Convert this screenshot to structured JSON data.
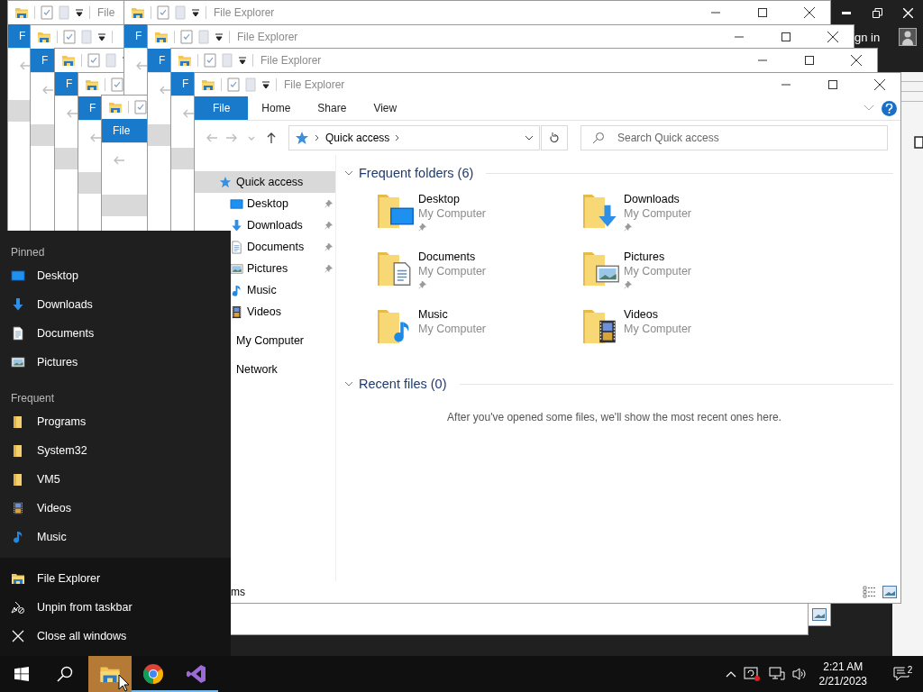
{
  "desktop_app": {
    "sign_in": "gn in"
  },
  "background_windows": [
    {
      "title": "File",
      "file_tab": "F"
    },
    {
      "file_tab": "F"
    },
    {
      "file_tab": "F"
    },
    {
      "file_tab": "F"
    },
    {
      "title": "File Explorer",
      "file_tab": "F"
    },
    {
      "file_tab": "File"
    },
    {
      "title": "File Explorer",
      "file_tab": "F"
    },
    {
      "title": "File Explorer",
      "file_tab": "F"
    }
  ],
  "main_window": {
    "title": "File Explorer",
    "ribbon_tabs": [
      {
        "label": "File",
        "selected": true
      },
      {
        "label": "Home",
        "selected": false
      },
      {
        "label": "Share",
        "selected": false
      },
      {
        "label": "View",
        "selected": false
      }
    ],
    "address": {
      "path": "Quick access"
    },
    "search": {
      "placeholder": "Search Quick access"
    },
    "nav_pane": [
      {
        "label": "Quick access",
        "selected": true,
        "children": [
          {
            "label": "Desktop",
            "kind": "desktop",
            "pinned": true
          },
          {
            "label": "Downloads",
            "kind": "downloads",
            "pinned": true
          },
          {
            "label": "Documents",
            "kind": "documents",
            "pinned": true
          },
          {
            "label": "Pictures",
            "kind": "pictures",
            "pinned": true
          },
          {
            "label": "Music",
            "kind": "music",
            "pinned": false
          },
          {
            "label": "Videos",
            "kind": "videos",
            "pinned": false
          }
        ]
      },
      {
        "label": "My Computer",
        "selected": false
      },
      {
        "label": "Network",
        "selected": false
      }
    ],
    "frequent_folders": {
      "heading": "Frequent folders (6)",
      "expanded": true,
      "items": [
        {
          "name": "Desktop",
          "location": "My Computer",
          "kind": "desktop",
          "pinned": true
        },
        {
          "name": "Downloads",
          "location": "My Computer",
          "kind": "downloads",
          "pinned": true
        },
        {
          "name": "Documents",
          "location": "My Computer",
          "kind": "documents",
          "pinned": true
        },
        {
          "name": "Pictures",
          "location": "My Computer",
          "kind": "pictures",
          "pinned": true
        },
        {
          "name": "Music",
          "location": "My Computer",
          "kind": "music",
          "pinned": false
        },
        {
          "name": "Videos",
          "location": "My Computer",
          "kind": "videos",
          "pinned": false
        }
      ]
    },
    "recent_files": {
      "heading": "Recent files (0)",
      "expanded": true,
      "empty_message": "After you've opened some files, we'll show the most recent ones here."
    },
    "status_bar": {
      "text": "ms"
    }
  },
  "jump_list": {
    "sections": [
      {
        "heading": "Pinned",
        "items": [
          {
            "label": "Desktop",
            "kind": "desktop"
          },
          {
            "label": "Downloads",
            "kind": "downloads"
          },
          {
            "label": "Documents",
            "kind": "documents"
          },
          {
            "label": "Pictures",
            "kind": "pictures"
          }
        ]
      },
      {
        "heading": "Frequent",
        "items": [
          {
            "label": "Programs",
            "kind": "folder"
          },
          {
            "label": "System32",
            "kind": "folder"
          },
          {
            "label": "VM5",
            "kind": "folder"
          },
          {
            "label": "Videos",
            "kind": "videos"
          },
          {
            "label": "Music",
            "kind": "music"
          }
        ]
      }
    ],
    "tasks": [
      {
        "label": "File Explorer",
        "kind": "explorer"
      },
      {
        "label": "Unpin from taskbar",
        "kind": "unpin"
      },
      {
        "label": "Close all windows",
        "kind": "close"
      }
    ]
  },
  "taskbar": {
    "apps": [
      {
        "kind": "explorer",
        "active": true
      },
      {
        "kind": "chrome",
        "active": false
      },
      {
        "kind": "studio",
        "active": false
      }
    ],
    "clock": {
      "time": "2:21 AM",
      "date": "2/21/2023"
    },
    "notifications": {
      "count": "2"
    }
  }
}
